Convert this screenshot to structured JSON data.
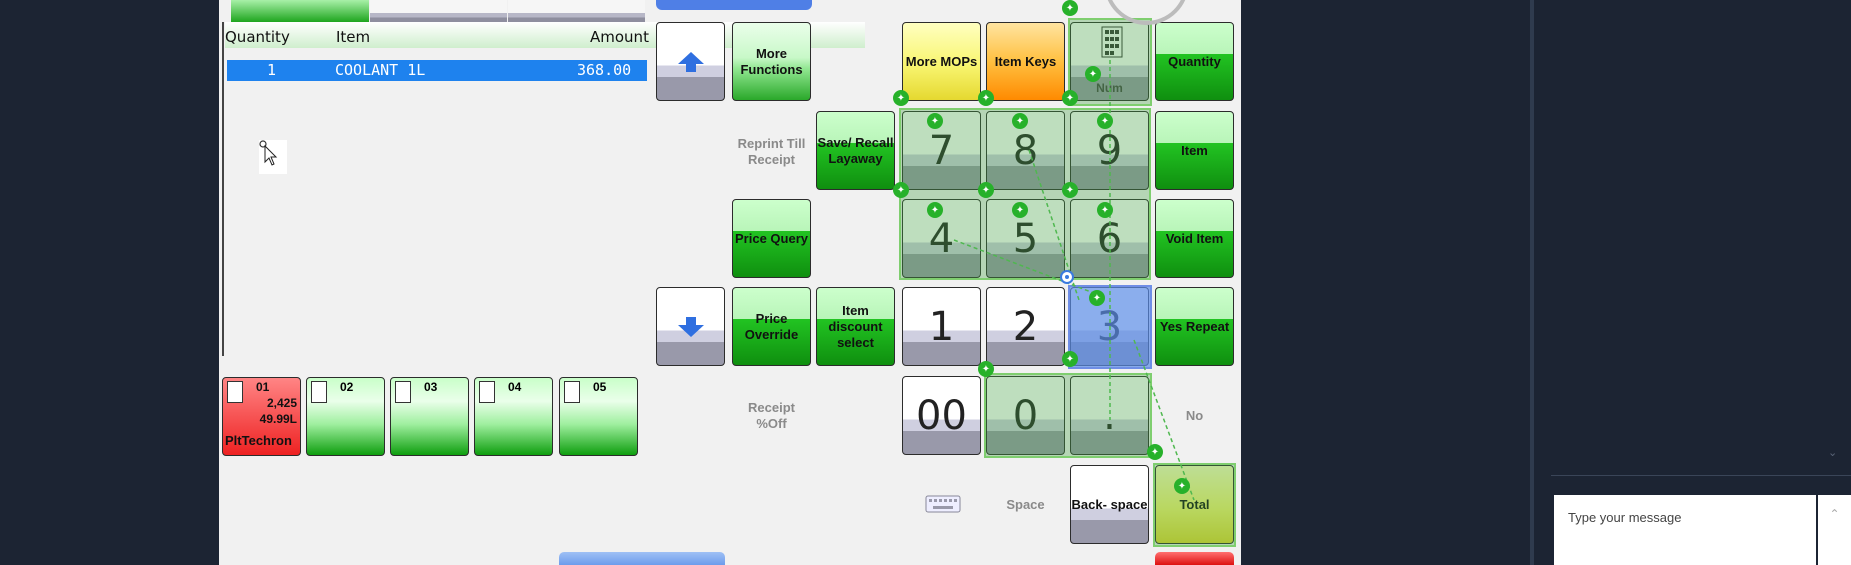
{
  "receipt": {
    "headers": {
      "quantity": "Quantity",
      "item": "Item",
      "amount": "Amount"
    },
    "row": {
      "qty": "1",
      "item": "COOLANT 1L",
      "amount": "368.00"
    }
  },
  "buttons": {
    "more_functions": "More Functions",
    "reprint_till_receipt": "Reprint Till Receipt",
    "save_recall_layaway": "Save/ Recall Layaway",
    "price_query": "Price Query",
    "price_override": "Price Override",
    "item_discount_select": "Item discount select",
    "receipt_pct_off": "Receipt %Off",
    "more_mops": "More MOPs",
    "item_keys": "Item Keys",
    "num": "Num",
    "quantity": "Quantity",
    "item": "Item",
    "void_item": "Void Item",
    "yes_repeat": "Yes Repeat",
    "no": "No",
    "space": "Space",
    "backspace": "Back- space",
    "total": "Total"
  },
  "keypad": {
    "k7": "7",
    "k8": "8",
    "k9": "9",
    "k4": "4",
    "k5": "5",
    "k6": "6",
    "k1": "1",
    "k2": "2",
    "k3": "3",
    "k00": "00",
    "k0": "0",
    "kdot": "."
  },
  "pumps": [
    {
      "id": "01",
      "volume": "2,425",
      "price": "49.99L",
      "product": "PltTechron",
      "status": "red"
    },
    {
      "id": "02",
      "status": "green"
    },
    {
      "id": "03",
      "status": "green"
    },
    {
      "id": "04",
      "status": "green"
    },
    {
      "id": "05",
      "status": "green"
    }
  ],
  "chat": {
    "placeholder": "Type your message"
  },
  "icons": {
    "up": "arrow-up-icon",
    "down": "arrow-down-icon",
    "keyboard": "keyboard-icon",
    "pin": "pin-icon",
    "pump": "fuel-pump-icon",
    "calc": "calculator-icon"
  },
  "colors": {
    "selected_row": "#1e82ee",
    "green_button": "#1ea51e",
    "overlay_green": "#7fce6f",
    "selected_key": "#5b8be6"
  }
}
